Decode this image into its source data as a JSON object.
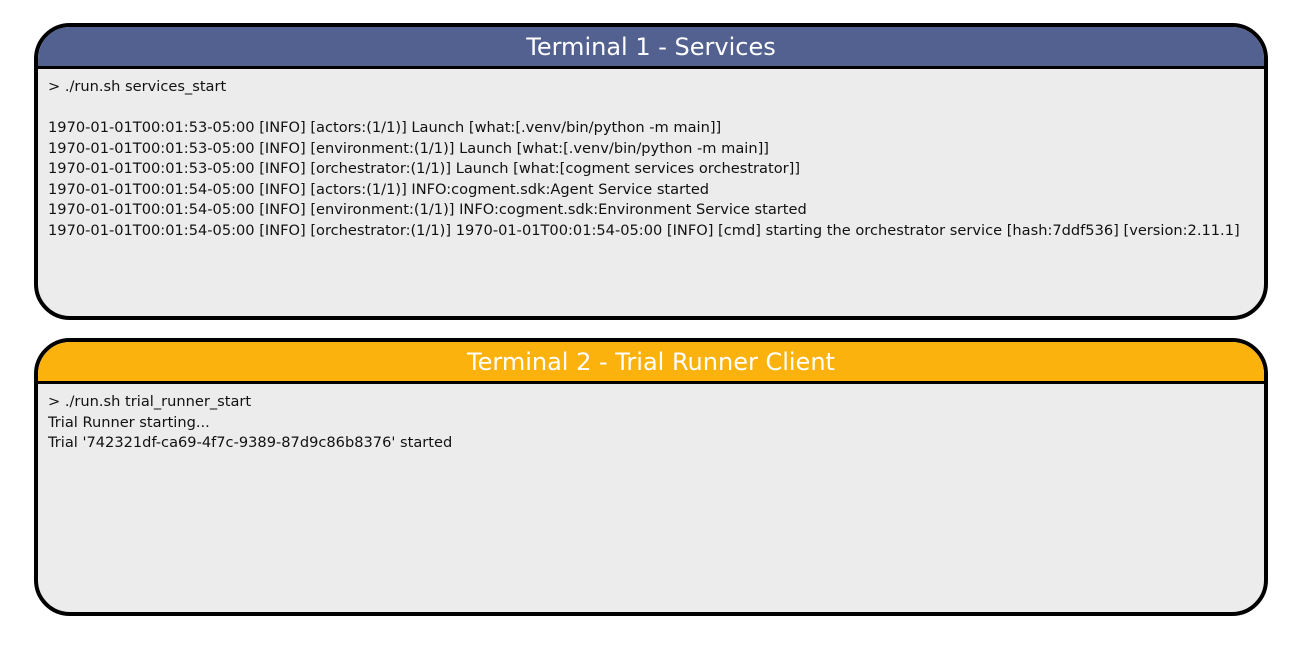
{
  "terminal1": {
    "title": "Terminal 1 - Services",
    "title_color": "#536190",
    "command": "> ./run.sh services_start",
    "lines": [
      "1970-01-01T00:01:53-05:00 [INFO] [actors:(1/1)] Launch [what:[.venv/bin/python -m main]]",
      "1970-01-01T00:01:53-05:00 [INFO] [environment:(1/1)] Launch [what:[.venv/bin/python -m main]]",
      "1970-01-01T00:01:53-05:00 [INFO] [orchestrator:(1/1)] Launch [what:[cogment services orchestrator]]",
      "1970-01-01T00:01:54-05:00 [INFO] [actors:(1/1)] INFO:cogment.sdk:Agent Service started",
      "1970-01-01T00:01:54-05:00 [INFO] [environment:(1/1)] INFO:cogment.sdk:Environment Service started",
      "1970-01-01T00:01:54-05:00 [INFO] [orchestrator:(1/1)] 1970-01-01T00:01:54-05:00 [INFO] [cmd] starting the orchestrator service [hash:7ddf536] [version:2.11.1]"
    ]
  },
  "terminal2": {
    "title": "Terminal 2 - Trial Runner Client",
    "title_color": "#fbb20d",
    "command": "> ./run.sh trial_runner_start",
    "lines": [
      "Trial Runner starting...",
      "Trial '742321df-ca69-4f7c-9389-87d9c86b8376' started"
    ]
  }
}
